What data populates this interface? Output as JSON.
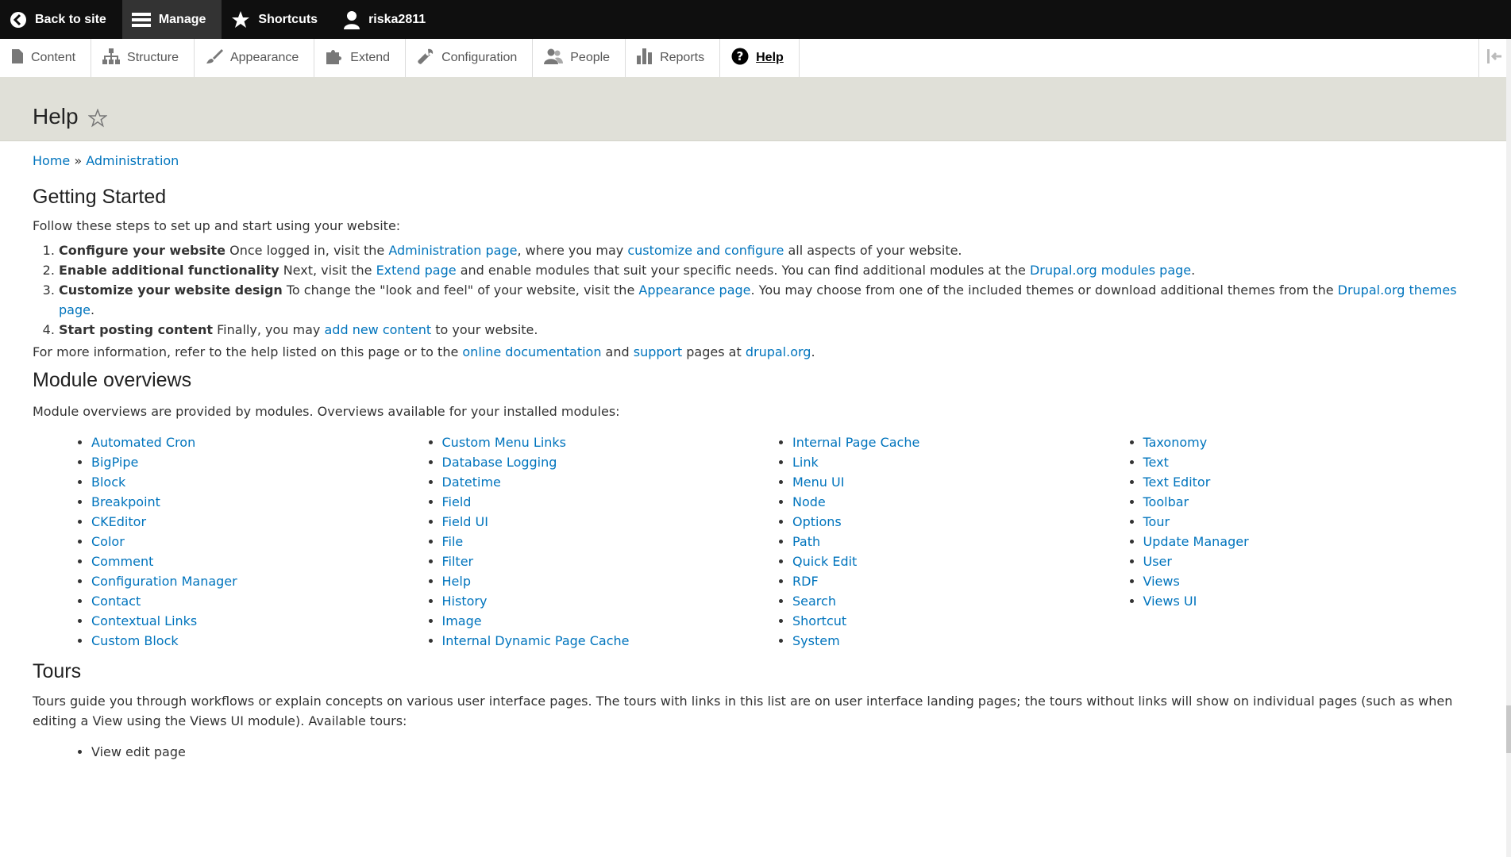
{
  "topbar": {
    "back_label": "Back to site",
    "manage_label": "Manage",
    "shortcuts_label": "Shortcuts",
    "user_label": "riska2811"
  },
  "tray": {
    "items": [
      {
        "label": "Content",
        "icon": "file-icon"
      },
      {
        "label": "Structure",
        "icon": "sitemap-icon"
      },
      {
        "label": "Appearance",
        "icon": "paintbrush-icon"
      },
      {
        "label": "Extend",
        "icon": "puzzle-icon"
      },
      {
        "label": "Configuration",
        "icon": "wrench-icon"
      },
      {
        "label": "People",
        "icon": "people-icon"
      },
      {
        "label": "Reports",
        "icon": "bar-chart-icon"
      },
      {
        "label": "Help",
        "icon": "help-icon"
      }
    ]
  },
  "page": {
    "title": "Help"
  },
  "breadcrumb": {
    "home": "Home",
    "sep": "»",
    "admin": "Administration"
  },
  "getting_started": {
    "heading": "Getting Started",
    "intro": "Follow these steps to set up and start using your website:",
    "steps": [
      {
        "strong": "Configure your website",
        "t1": " Once logged in, visit the ",
        "l1": "Administration page",
        "t2": ", where you may ",
        "l2": "customize and configure",
        "t3": " all aspects of your website."
      },
      {
        "strong": "Enable additional functionality",
        "t1": " Next, visit the ",
        "l1": "Extend page",
        "t2": " and enable modules that suit your specific needs. You can find additional modules at the ",
        "l2": "Drupal.org modules page",
        "t3": "."
      },
      {
        "strong": "Customize your website design",
        "t1": " To change the \"look and feel\" of your website, visit the ",
        "l1": "Appearance page",
        "t2": ". You may choose from one of the included themes or download additional themes from the ",
        "l2": "Drupal.org themes page",
        "t3": "."
      },
      {
        "strong": "Start posting content",
        "t1": " Finally, you may ",
        "l1": "add new content",
        "t2": " to your website."
      }
    ],
    "more": {
      "t1": "For more information, refer to the help listed on this page or to the ",
      "l1": "online documentation",
      "t2": " and ",
      "l2": "support",
      "t3": " pages at ",
      "l3": "drupal.org",
      "t4": "."
    }
  },
  "module_overviews": {
    "heading": "Module overviews",
    "intro": "Module overviews are provided by modules. Overviews available for your installed modules:",
    "columns": [
      [
        "Automated Cron",
        "BigPipe",
        "Block",
        "Breakpoint",
        "CKEditor",
        "Color",
        "Comment",
        "Configuration Manager",
        "Contact",
        "Contextual Links",
        "Custom Block"
      ],
      [
        "Custom Menu Links",
        "Database Logging",
        "Datetime",
        "Field",
        "Field UI",
        "File",
        "Filter",
        "Help",
        "History",
        "Image",
        "Internal Dynamic Page Cache"
      ],
      [
        "Internal Page Cache",
        "Link",
        "Menu UI",
        "Node",
        "Options",
        "Path",
        "Quick Edit",
        "RDF",
        "Search",
        "Shortcut",
        "System"
      ],
      [
        "Taxonomy",
        "Text",
        "Text Editor",
        "Toolbar",
        "Tour",
        "Update Manager",
        "User",
        "Views",
        "Views UI"
      ]
    ]
  },
  "tours": {
    "heading": "Tours",
    "intro": "Tours guide you through workflows or explain concepts on various user interface pages. The tours with links in this list are on user interface landing pages; the tours without links will show on individual pages (such as when editing a View using the Views UI module). Available tours:",
    "items": [
      "View edit page"
    ]
  },
  "colors": {
    "link": "#0074bd",
    "topbar": "#0f0f0f",
    "header_bg": "#e0e0d8"
  }
}
